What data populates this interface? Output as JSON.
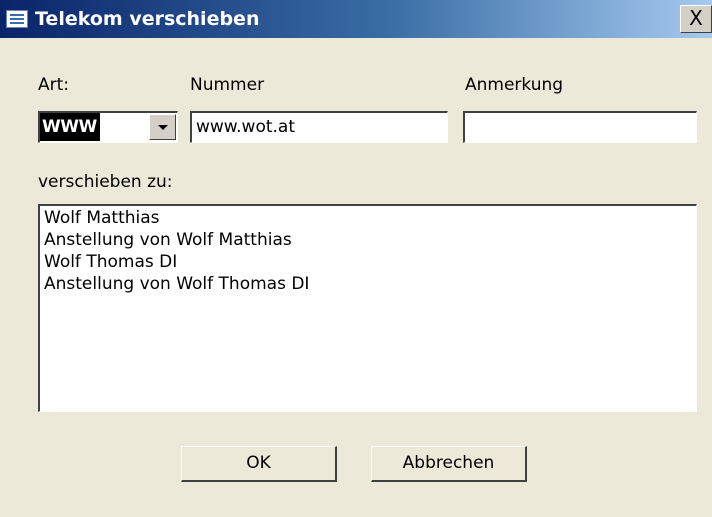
{
  "window": {
    "title": "Telekom verschieben",
    "close_label": "X"
  },
  "labels": {
    "art": "Art:",
    "nummer": "Nummer",
    "anmerkung": "Anmerkung",
    "verschieben_zu": "verschieben zu:"
  },
  "fields": {
    "art_value": "WWW",
    "nummer_value": "www.wot.at",
    "anmerkung_value": ""
  },
  "list": {
    "items": [
      "Wolf Matthias",
      "Anstellung von Wolf Matthias",
      "Wolf Thomas DI",
      "Anstellung von Wolf Thomas DI"
    ]
  },
  "buttons": {
    "ok": "OK",
    "cancel": "Abbrechen"
  }
}
